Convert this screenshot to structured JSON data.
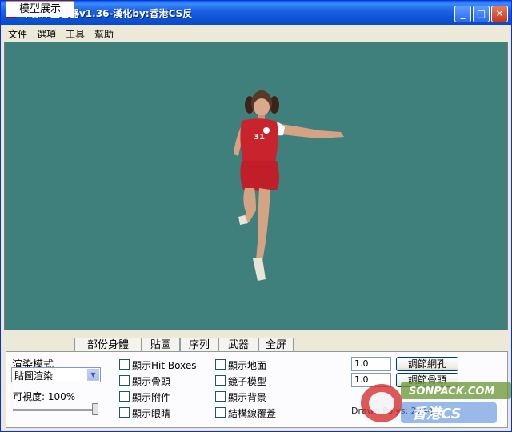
{
  "window": {
    "title": "半條命查看器v1.36-漢化by:香港CS反",
    "buttons": [
      "_",
      "□",
      "✕"
    ]
  },
  "menubar": {
    "items": [
      "文件",
      "選項",
      "工具",
      "幫助"
    ]
  },
  "viewport": {
    "background": "#3f807c",
    "model_jersey_number": "31"
  },
  "tabs": [
    "模型展示",
    "部份身體",
    "貼圖",
    "序列",
    "武器",
    "全屏"
  ],
  "panel": {
    "render_mode_label": "渲染模式",
    "render_mode_value": "貼圖渲染",
    "visibility_label": "可視度: 100%",
    "visibility_value": 100,
    "checkboxes_col1": [
      "顯示Hit Boxes",
      "顯示骨頭",
      "顯示附件",
      "顯示眼睛"
    ],
    "checkboxes_col2": [
      "顯示地面",
      "鏡子模型",
      "顯示背景",
      "結構線覆蓋"
    ],
    "inputs": [
      "1.0",
      "1.0"
    ],
    "buttons": [
      "調節網孔",
      "調節骨頭"
    ],
    "drawn_polys": "Drawn Polys: 2744"
  },
  "watermark": {
    "line1": "SONPACK.COM",
    "line2": "香港CS"
  },
  "colors": {
    "titlebar": "#0c58dd",
    "panel_bg": "#ece9d8",
    "active_tab_accent": "#e68b2c"
  }
}
